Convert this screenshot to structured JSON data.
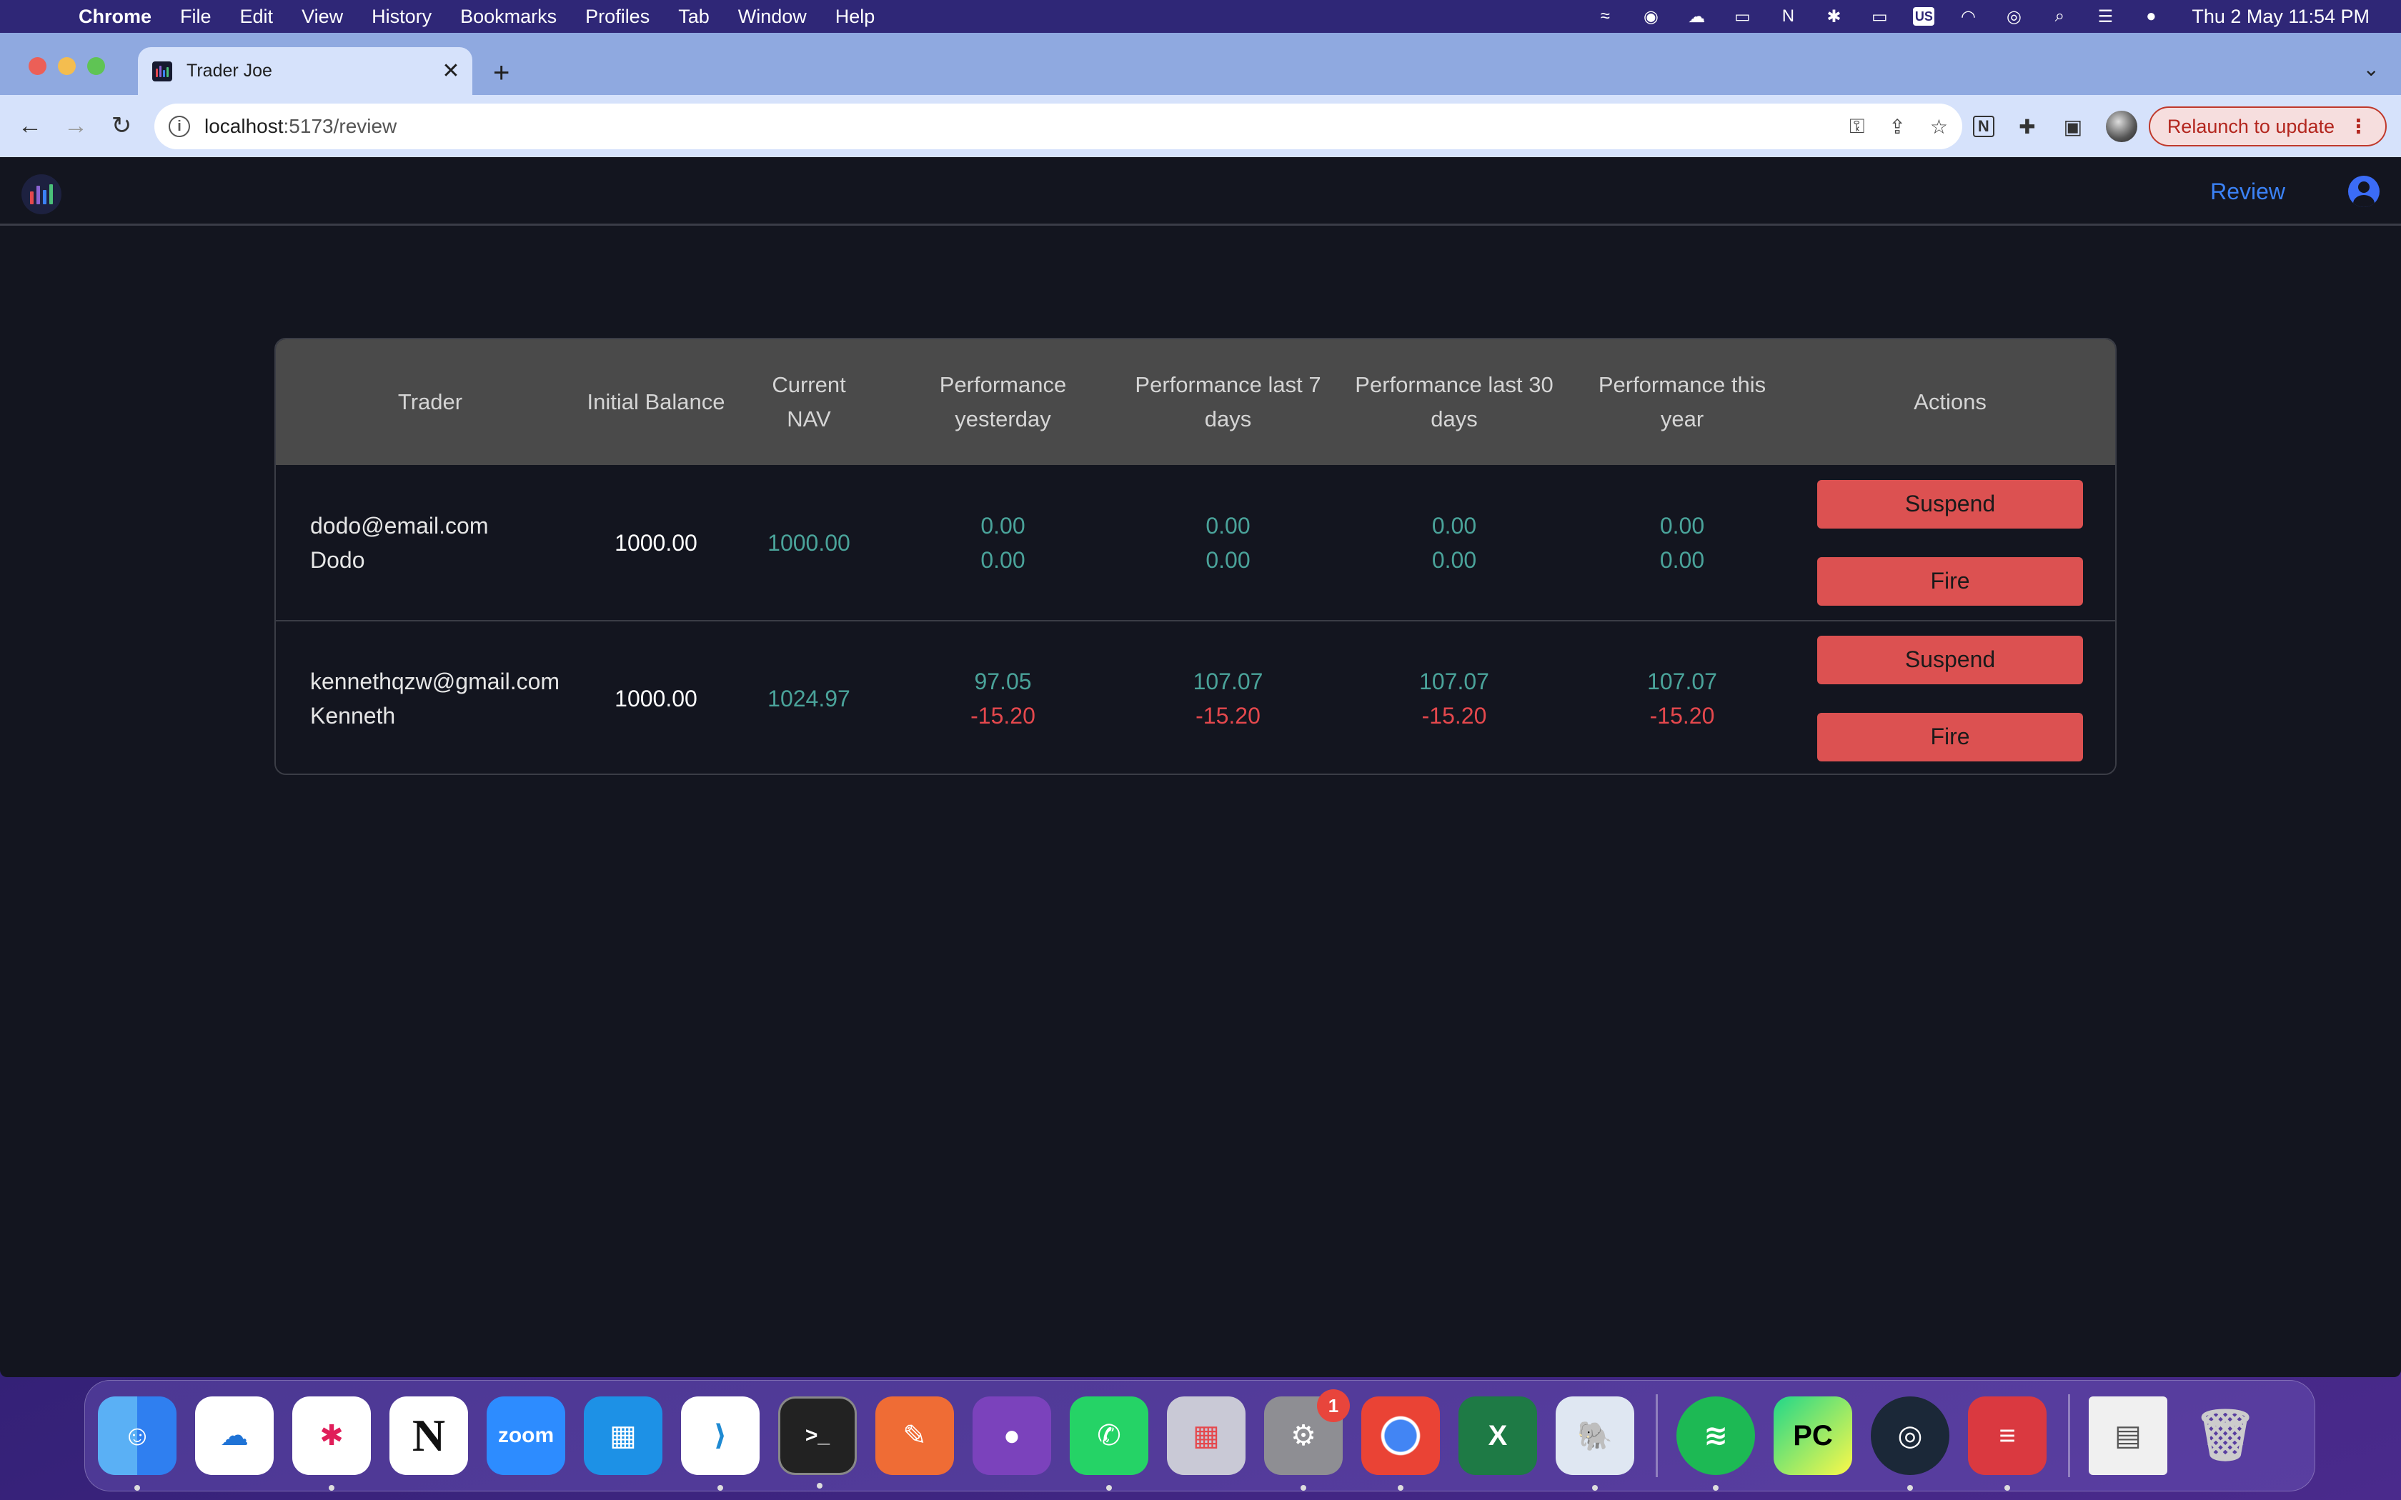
{
  "menubar": {
    "app_name": "Chrome",
    "items": [
      "File",
      "Edit",
      "View",
      "History",
      "Bookmarks",
      "Profiles",
      "Tab",
      "Window",
      "Help"
    ],
    "clock": "Thu 2 May  11:54 PM",
    "input_source": "US"
  },
  "browser": {
    "tab_title": "Trader Joe",
    "url_host": "localhost",
    "url_path": ":5173/review",
    "relaunch_label": "Relaunch to update"
  },
  "app": {
    "nav_review": "Review"
  },
  "table": {
    "headers": {
      "trader": "Trader",
      "initial_balance": "Initial Balance",
      "current_nav": "Current NAV",
      "perf_yesterday": "Performance yesterday",
      "perf_7": "Performance last 7 days",
      "perf_30": "Performance last 30 days",
      "perf_year": "Performance this year",
      "actions": "Actions"
    },
    "rows": [
      {
        "email": "dodo@email.com",
        "name": "Dodo",
        "initial_balance": "1000.00",
        "current_nav": "1000.00",
        "perf_yesterday": [
          "0.00",
          "0.00"
        ],
        "perf_7": [
          "0.00",
          "0.00"
        ],
        "perf_30": [
          "0.00",
          "0.00"
        ],
        "perf_year": [
          "0.00",
          "0.00"
        ],
        "suspend_label": "Suspend",
        "fire_label": "Fire"
      },
      {
        "email": "kennethqzw@gmail.com",
        "name": "Kenneth",
        "initial_balance": "1000.00",
        "current_nav": "1024.97",
        "perf_yesterday": [
          "97.05",
          "-15.20"
        ],
        "perf_7": [
          "107.07",
          "-15.20"
        ],
        "perf_30": [
          "107.07",
          "-15.20"
        ],
        "perf_year": [
          "107.07",
          "-15.20"
        ],
        "suspend_label": "Suspend",
        "fire_label": "Fire"
      }
    ]
  },
  "colors": {
    "positive": "#4aa39a",
    "negative": "#e5484d",
    "button": "#dc5151",
    "link": "#3b82f6",
    "page_bg": "#13151f",
    "header_bg": "#4a4a4a"
  },
  "dock": {
    "apps": [
      "finder-icon",
      "onedrive-icon",
      "slack-icon",
      "notion-icon",
      "zoom-icon",
      "docker-icon",
      "vscode-icon",
      "terminal-icon",
      "postman-icon",
      "github-desktop-icon",
      "whatsapp-icon",
      "launchpad-icon",
      "system-settings-icon",
      "chrome-icon",
      "excel-icon",
      "pgadmin-icon",
      "spotify-icon",
      "pycharm-icon",
      "steam-icon",
      "expressvpn-icon",
      "documents-stack-icon",
      "trash-icon"
    ],
    "zoom_label": "zoom",
    "pycharm_label": "PC",
    "excel_label": "X",
    "notion_label": "N",
    "settings_badge": "1"
  }
}
